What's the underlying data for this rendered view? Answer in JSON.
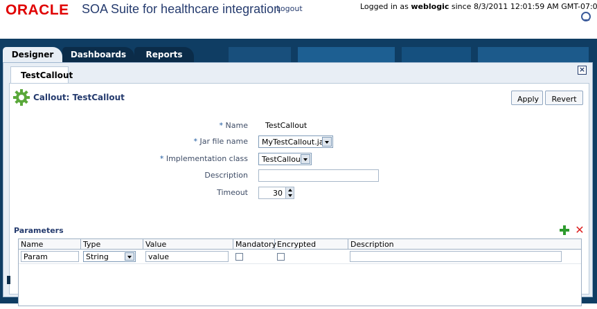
{
  "header": {
    "brand": "ORACLE",
    "product": "SOA Suite for healthcare integration",
    "logout": "Logout",
    "logged_in_prefix": "Logged in as",
    "user": "weblogic",
    "logged_in_suffix": "since 8/3/2011 12:01:59 AM GMT-07:00",
    "status_icon": "status-ring-icon"
  },
  "tabs": [
    {
      "label": "Designer",
      "selected": true
    },
    {
      "label": "Dashboards",
      "selected": false
    },
    {
      "label": "Reports",
      "selected": false
    }
  ],
  "subtab": {
    "label": "TestCallout"
  },
  "callout": {
    "title": "Callout: TestCallout",
    "icon": "gear-icon",
    "apply_label": "Apply",
    "revert_label": "Revert"
  },
  "form": {
    "name_label": "Name",
    "name_value": "TestCallout",
    "jar_label": "Jar file name",
    "jar_value": "MyTestCallout.jar",
    "impl_label": "Implementation class",
    "impl_value": "TestCallout",
    "description_label": "Description",
    "description_value": "",
    "timeout_label": "Timeout",
    "timeout_value": "30",
    "required_marker": "*"
  },
  "parameters": {
    "title": "Parameters",
    "columns": [
      "Name",
      "Type",
      "Value",
      "Mandatory",
      "Encrypted",
      "Description"
    ],
    "rows": [
      {
        "name": "Param",
        "type": "String",
        "value": "value",
        "mandatory": false,
        "encrypted": false,
        "description": ""
      }
    ]
  },
  "colors": {
    "brand_red": "#e00000",
    "title_blue": "#253b6e",
    "band": "#0f3d63"
  }
}
